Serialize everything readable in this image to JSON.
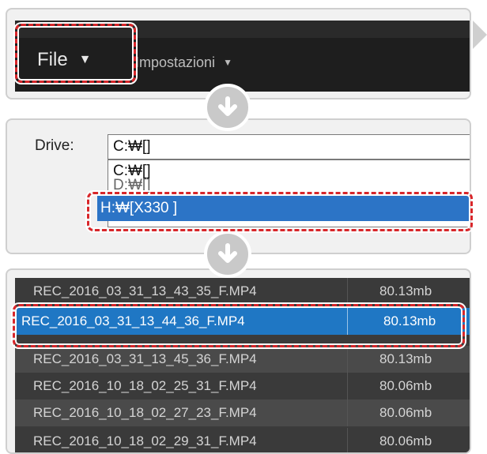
{
  "menubar": {
    "file_label": "File",
    "settings_label": "Impostazioni"
  },
  "drive": {
    "label": "Drive:",
    "current_value": "C:₩[]",
    "options": [
      "C:₩[]",
      "D:₩[]"
    ],
    "selected_option": "H:₩[X330 ]"
  },
  "files": {
    "rows": [
      {
        "name": "REC_2016_03_31_13_43_35_F.MP4",
        "size": "80.13mb",
        "selected": false
      },
      {
        "name": "REC_2016_03_31_13_44_36_F.MP4",
        "size": "80.13mb",
        "selected": true
      },
      {
        "name": "REC_2016_03_31_13_45_36_F.MP4",
        "size": "80.13mb",
        "selected": false
      },
      {
        "name": "REC_2016_10_18_02_25_31_F.MP4",
        "size": "80.06mb",
        "selected": false
      },
      {
        "name": "REC_2016_10_18_02_27_23_F.MP4",
        "size": "80.06mb",
        "selected": false
      },
      {
        "name": "REC_2016_10_18_02_29_31_F.MP4",
        "size": "80.06mb",
        "selected": false
      }
    ]
  },
  "colors": {
    "highlight": "#d8262a",
    "selection": "#2c74c6",
    "menubar": "#1e1e1e"
  },
  "icons": {
    "menu_caret": "caret-down-icon",
    "step_arrow": "arrow-down-circle-icon",
    "next_arrow": "triangle-right-icon"
  }
}
